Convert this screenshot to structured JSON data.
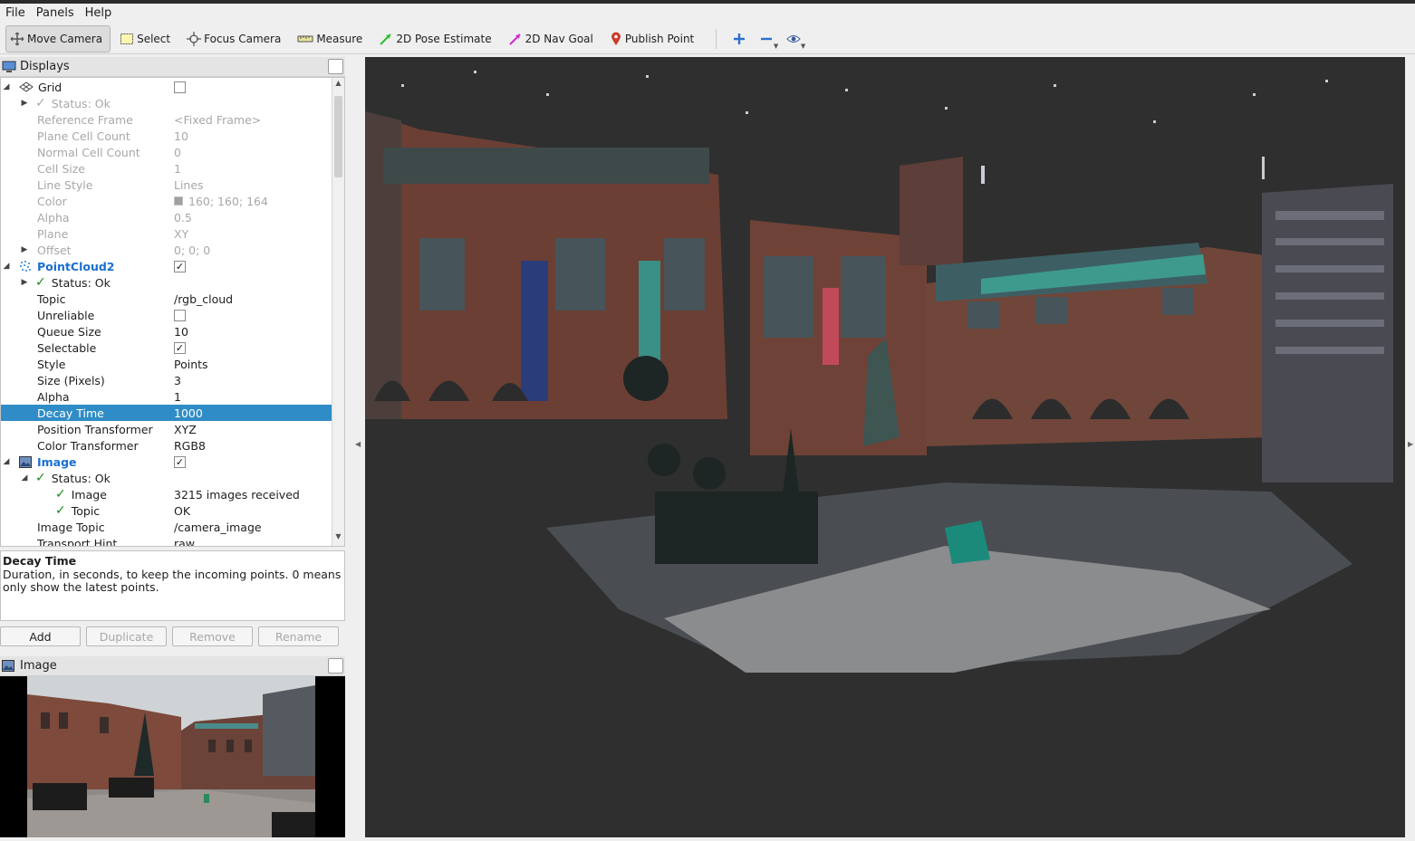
{
  "menu": [
    "File",
    "Panels",
    "Help"
  ],
  "toolbar": {
    "move_camera": "Move Camera",
    "select": "Select",
    "focus_camera": "Focus Camera",
    "measure": "Measure",
    "pose_estimate": "2D Pose Estimate",
    "nav_goal": "2D Nav Goal",
    "publish_point": "Publish Point"
  },
  "displays_panel": {
    "title": "Displays"
  },
  "tree": {
    "grid": {
      "label": "Grid",
      "status": "Status: Ok",
      "reference_frame": {
        "name": "Reference Frame",
        "value": "<Fixed Frame>"
      },
      "plane_cell_count": {
        "name": "Plane Cell Count",
        "value": "10"
      },
      "normal_cell_count": {
        "name": "Normal Cell Count",
        "value": "0"
      },
      "cell_size": {
        "name": "Cell Size",
        "value": "1"
      },
      "line_style": {
        "name": "Line Style",
        "value": "Lines"
      },
      "color": {
        "name": "Color",
        "value": "160; 160; 164"
      },
      "alpha": {
        "name": "Alpha",
        "value": "0.5"
      },
      "plane": {
        "name": "Plane",
        "value": "XY"
      },
      "offset": {
        "name": "Offset",
        "value": "0; 0; 0"
      }
    },
    "pointcloud": {
      "label": "PointCloud2",
      "status": "Status: Ok",
      "topic": {
        "name": "Topic",
        "value": "/rgb_cloud"
      },
      "unreliable": {
        "name": "Unreliable"
      },
      "queue_size": {
        "name": "Queue Size",
        "value": "10"
      },
      "selectable": {
        "name": "Selectable"
      },
      "style": {
        "name": "Style",
        "value": "Points"
      },
      "size": {
        "name": "Size (Pixels)",
        "value": "3"
      },
      "alpha": {
        "name": "Alpha",
        "value": "1"
      },
      "decay": {
        "name": "Decay Time",
        "value": "1000"
      },
      "position_transformer": {
        "name": "Position Transformer",
        "value": "XYZ"
      },
      "color_transformer": {
        "name": "Color Transformer",
        "value": "RGB8"
      }
    },
    "image": {
      "label": "Image",
      "status": "Status: Ok",
      "image_status": {
        "name": "Image",
        "value": "3215 images received"
      },
      "topic_status": {
        "name": "Topic",
        "value": "OK"
      },
      "image_topic": {
        "name": "Image Topic",
        "value": "/camera_image"
      },
      "transport_hint": {
        "name": "Transport Hint",
        "value": "raw"
      }
    }
  },
  "description": {
    "title": "Decay Time",
    "text": "Duration, in seconds, to keep the incoming points. 0 means only show the latest points."
  },
  "buttons": {
    "add": "Add",
    "duplicate": "Duplicate",
    "remove": "Remove",
    "rename": "Rename"
  },
  "image_panel": {
    "title": "Image"
  },
  "colors": {
    "selection": "#308cc6",
    "viewport_bg": "#2f2f2f",
    "accent_blue": "#1a6fd0"
  }
}
